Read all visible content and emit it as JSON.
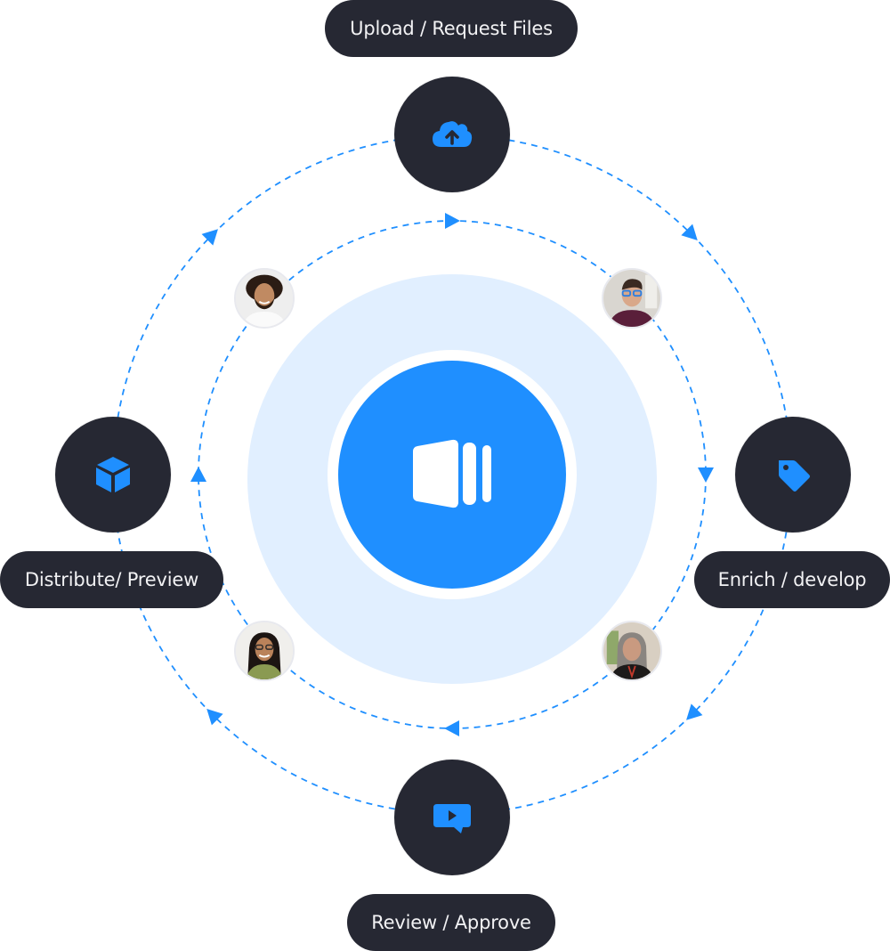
{
  "diagram": {
    "flow_direction": "clockwise",
    "colors": {
      "accent": "#1f8fff",
      "node_bg": "#262833",
      "halo": "#e1efff",
      "label_text": "#f2f2f4"
    },
    "hub": {
      "icon": "app-logo-icon"
    },
    "steps": [
      {
        "id": "upload",
        "label": "Upload / Request Files",
        "icon": "cloud-upload-icon"
      },
      {
        "id": "enrich",
        "label": "Enrich / develop",
        "icon": "tag-icon"
      },
      {
        "id": "review",
        "label": "Review / Approve",
        "icon": "video-comment-icon"
      },
      {
        "id": "distribute",
        "label": "Distribute/ Preview",
        "icon": "cube-icon"
      }
    ],
    "collaborators": [
      {
        "position": "top-left",
        "icon": "avatar-curly-hair-man"
      },
      {
        "position": "top-right",
        "icon": "avatar-man-blue-glasses"
      },
      {
        "position": "bottom-left",
        "icon": "avatar-long-hair-man-glasses"
      },
      {
        "position": "bottom-right",
        "icon": "avatar-gray-hair-woman"
      }
    ]
  }
}
